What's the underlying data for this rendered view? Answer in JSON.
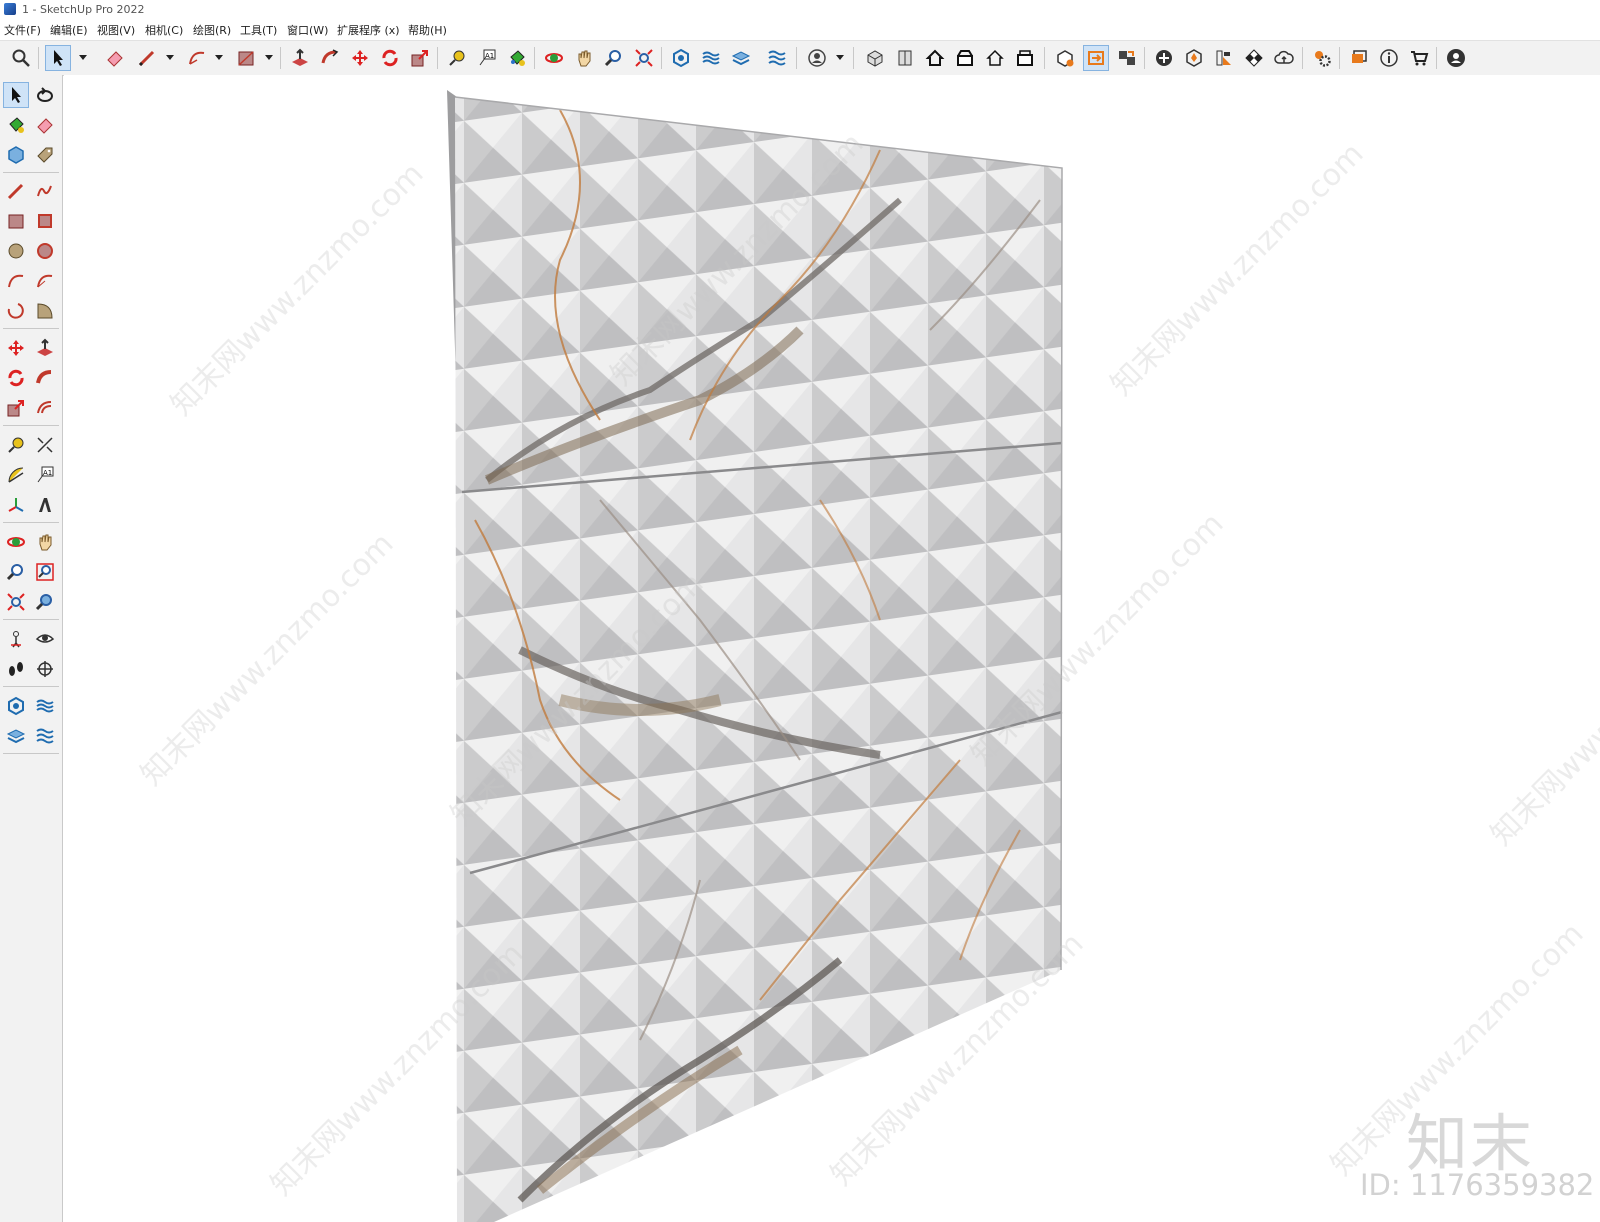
{
  "window": {
    "title": "1 - SketchUp Pro 2022"
  },
  "menu": [
    "文件(F)",
    "编辑(E)",
    "视图(V)",
    "相机(C)",
    "绘图(R)",
    "工具(T)",
    "窗口(W)",
    "扩展程序 (x)",
    "帮助(H)"
  ],
  "toolbar_icons": [
    "search-icon",
    "select-icon",
    "eraser-icon",
    "pencil-icon",
    "arc-icon",
    "rectangle-icon",
    "push-pull-icon",
    "follow-me-icon",
    "move-icon",
    "rotate-icon",
    "scale-icon",
    "tape-measure-icon",
    "text-icon",
    "paint-bucket-icon",
    "orbit-icon",
    "pan-icon",
    "zoom-icon",
    "zoom-extents-icon",
    "solid-tools-icon",
    "sandbox-icon",
    "layers-icon",
    "section-icon",
    "account-icon",
    "iso-view-icon",
    "top-view-icon",
    "front-view-icon",
    "right-view-icon",
    "back-view-icon",
    "left-view-icon",
    "warehouse-icon",
    "style-icon",
    "scene-icon",
    "add-location-icon",
    "geo-icon",
    "materials-icon",
    "chess-icon",
    "cloud-icon",
    "extension-manager-icon",
    "message-icon",
    "info-icon",
    "cart-icon",
    "user-icon"
  ],
  "sidebar_icons": [
    "select-tool-icon",
    "orbit-tool-icon",
    "paint-tool-icon",
    "eraser-tool-icon",
    "component-tool-icon",
    "tag-tool-icon",
    "line-tool-icon",
    "freehand-tool-icon",
    "rectangle-tool-icon",
    "rotated-rect-tool-icon",
    "circle-tool-icon",
    "polygon-tool-icon",
    "arc-tool-icon",
    "two-point-arc-tool-icon",
    "three-point-arc-tool-icon",
    "pie-tool-icon",
    "move-tool-icon",
    "push-pull-tool-icon",
    "rotate-tool-icon",
    "follow-me-tool-icon",
    "scale-tool-icon",
    "offset-tool-icon",
    "tape-tool-icon",
    "dimension-tool-icon",
    "protractor-tool-icon",
    "text-tool-icon",
    "axes-tool-icon",
    "3d-text-tool-icon",
    "orbit-nav-icon",
    "pan-nav-icon",
    "zoom-nav-icon",
    "zoom-window-icon",
    "zoom-extents-nav-icon",
    "previous-view-icon",
    "position-camera-icon",
    "look-around-icon",
    "walk-icon",
    "section-plane-icon",
    "solid-outer-shell-icon",
    "sandbox-contour-icon",
    "layers-manage-icon",
    "sandbox-stamp-icon"
  ],
  "watermark": {
    "repeat_text": "知末网www.znzmo.com",
    "logo": "知末",
    "id": "ID: 1176359382"
  },
  "colors": {
    "accent": "#cfe3f7",
    "panel": "#f2f2f2"
  }
}
